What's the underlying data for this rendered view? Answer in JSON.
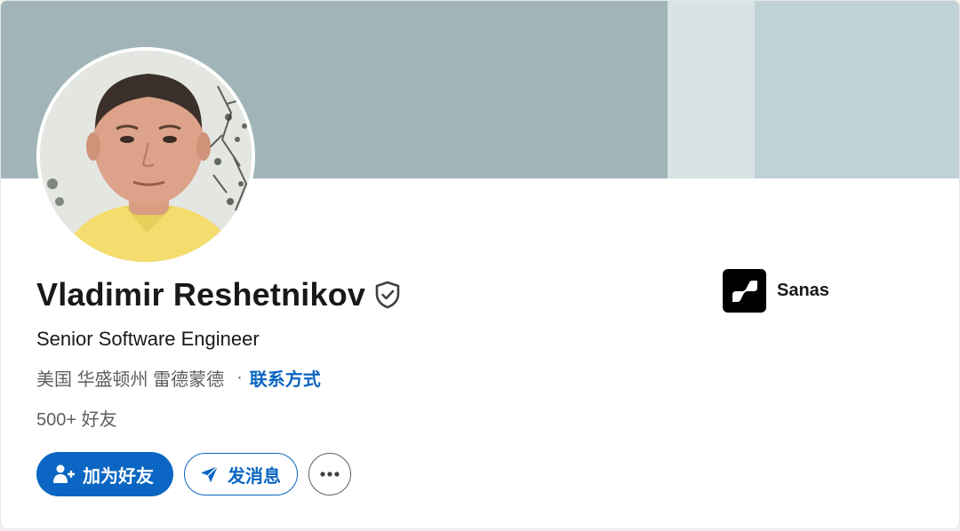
{
  "profile": {
    "name": "Vladimir Reshetnikov",
    "headline": "Senior Software Engineer",
    "location": "美国 华盛顿州 雷德蒙德",
    "dot_separator": "·",
    "contact_info_label": "联系方式",
    "connections": "500+ 好友"
  },
  "actions": {
    "add_friend_label": "加为好友",
    "message_label": "发消息",
    "more_label": "···"
  },
  "company": {
    "name": "Sanas"
  },
  "colors": {
    "accent": "#0a66c2",
    "banner": "#a1b5b8",
    "banner_light": "#d8e3e5",
    "banner_right": "#bfd2d6"
  },
  "icons": {
    "verified": "shield-check-icon",
    "add_person": "add-person-icon",
    "send": "send-icon",
    "more": "more-horizontal-icon",
    "company_logo": "sanas-logo-icon"
  }
}
